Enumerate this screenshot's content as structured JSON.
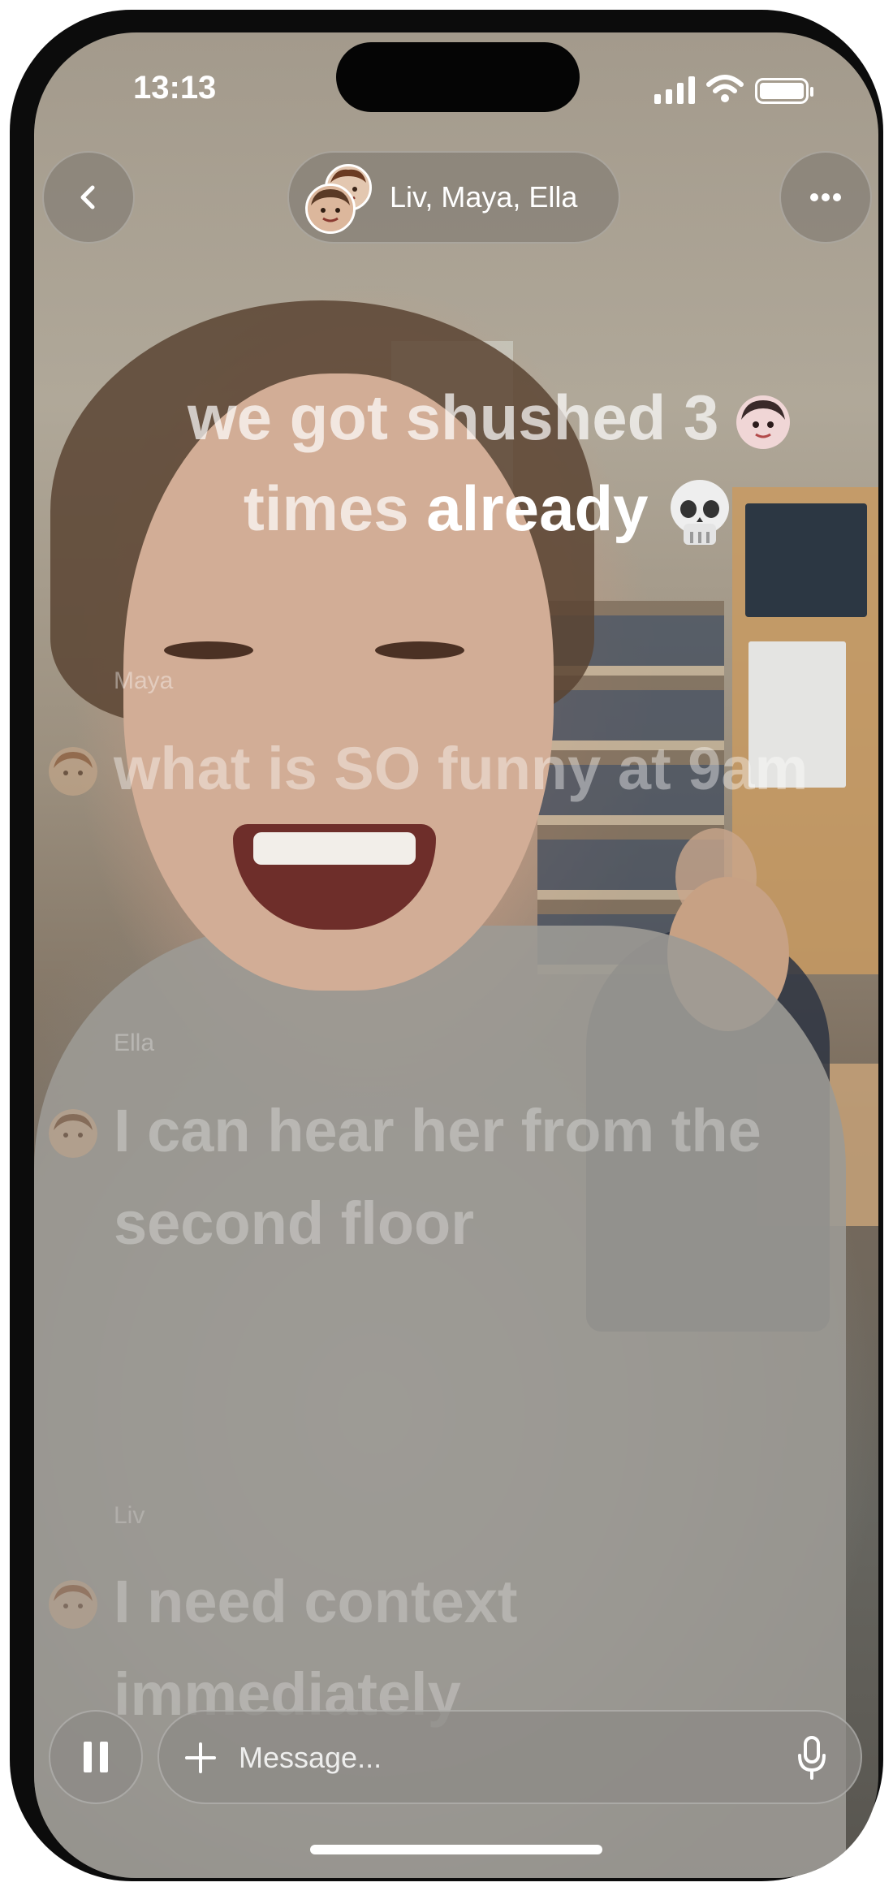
{
  "status_bar": {
    "time": "13:13"
  },
  "header": {
    "chat_title": "Liv, Maya, Ella"
  },
  "messages": {
    "main": {
      "part1": "we got shushed 3",
      "part2": "times ",
      "part3": "already"
    },
    "m1": {
      "sender": "Maya",
      "text": "what is SO funny at 9am"
    },
    "m2": {
      "sender": "Ella",
      "text": "I can hear her from the second floor"
    },
    "m3": {
      "sender": "Liv",
      "text": "I need context immediately"
    }
  },
  "composer": {
    "placeholder": "Message..."
  },
  "icons": {
    "back": "chevron-left-icon",
    "more": "ellipsis-icon",
    "pause": "pause-icon",
    "add": "plus-icon",
    "mic": "microphone-icon",
    "skull": "skull-emoji"
  },
  "colors": {
    "text": "#ffffff",
    "glass": "#78736c"
  }
}
